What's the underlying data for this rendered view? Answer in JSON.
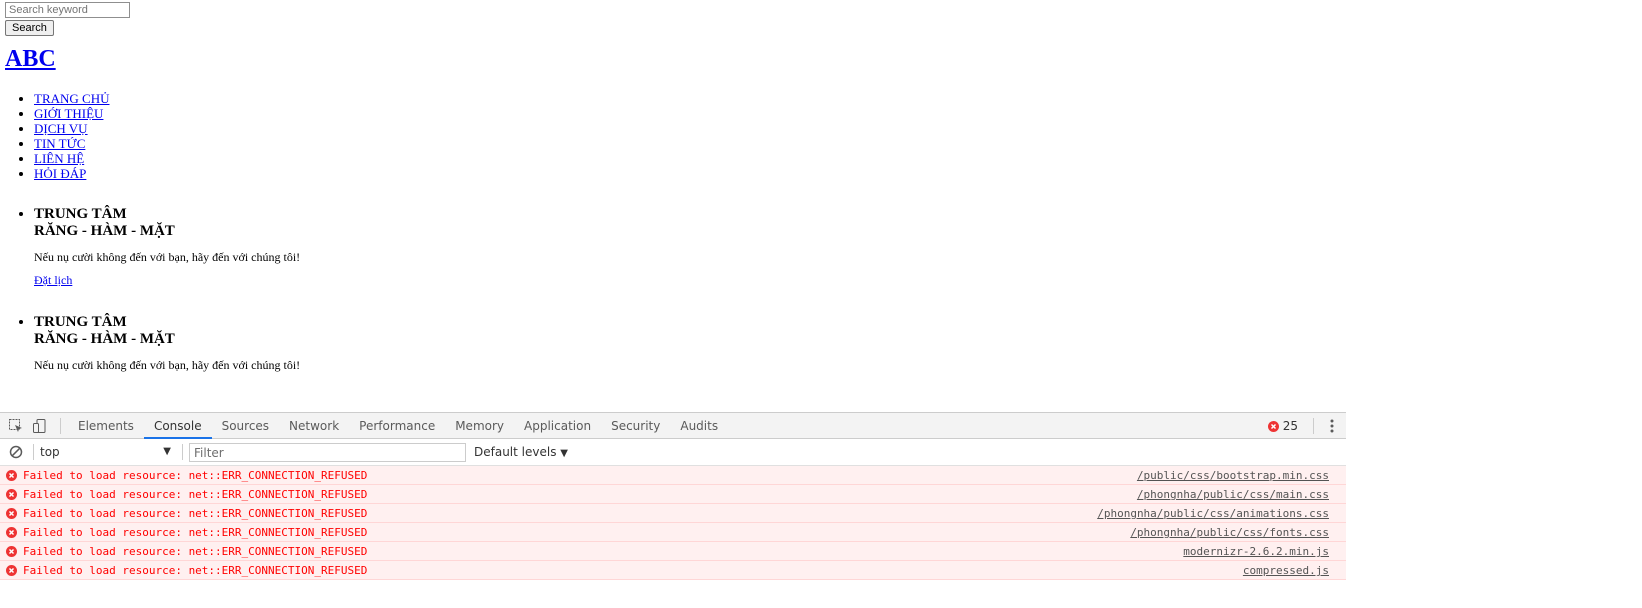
{
  "search": {
    "placeholder": "Search keyword",
    "button_label": "Search"
  },
  "logo": "ABC",
  "nav": [
    "TRANG CHỦ",
    "GIỚI THIỆU",
    "DỊCH VỤ",
    "TIN TỨC",
    "LIÊN HỆ",
    "HỎI ĐÁP"
  ],
  "slides": [
    {
      "title_line1": "TRUNG TÂM",
      "title_line2": "RĂNG - HÀM - MẶT",
      "text": "Nếu nụ cười không đến với bạn, hãy đến với chúng tôi!",
      "link": "Đặt lịch"
    },
    {
      "title_line1": "TRUNG TÂM",
      "title_line2": "RĂNG - HÀM - MẶT",
      "text": "Nếu nụ cười không đến với bạn, hãy đến với chúng tôi!"
    }
  ],
  "devtools": {
    "tabs": [
      "Elements",
      "Console",
      "Sources",
      "Network",
      "Performance",
      "Memory",
      "Application",
      "Security",
      "Audits"
    ],
    "active_tab": "Console",
    "error_count": "25",
    "context": "top",
    "filter_placeholder": "Filter",
    "levels": "Default levels",
    "colors": {
      "error_text": "#ff0000",
      "error_bg": "#fff0f0",
      "active_tab_accent": "#1a73e8"
    },
    "messages": [
      {
        "text": "Failed to load resource: net::ERR_CONNECTION_REFUSED",
        "source": "/public/css/bootstrap.min.css"
      },
      {
        "text": "Failed to load resource: net::ERR_CONNECTION_REFUSED",
        "source": "/phongnha/public/css/main.css"
      },
      {
        "text": "Failed to load resource: net::ERR_CONNECTION_REFUSED",
        "source": "/phongnha/public/css/animations.css"
      },
      {
        "text": "Failed to load resource: net::ERR_CONNECTION_REFUSED",
        "source": "/phongnha/public/css/fonts.css"
      },
      {
        "text": "Failed to load resource: net::ERR_CONNECTION_REFUSED",
        "source": "modernizr-2.6.2.min.js"
      },
      {
        "text": "Failed to load resource: net::ERR_CONNECTION_REFUSED",
        "source": "compressed.js"
      }
    ]
  }
}
